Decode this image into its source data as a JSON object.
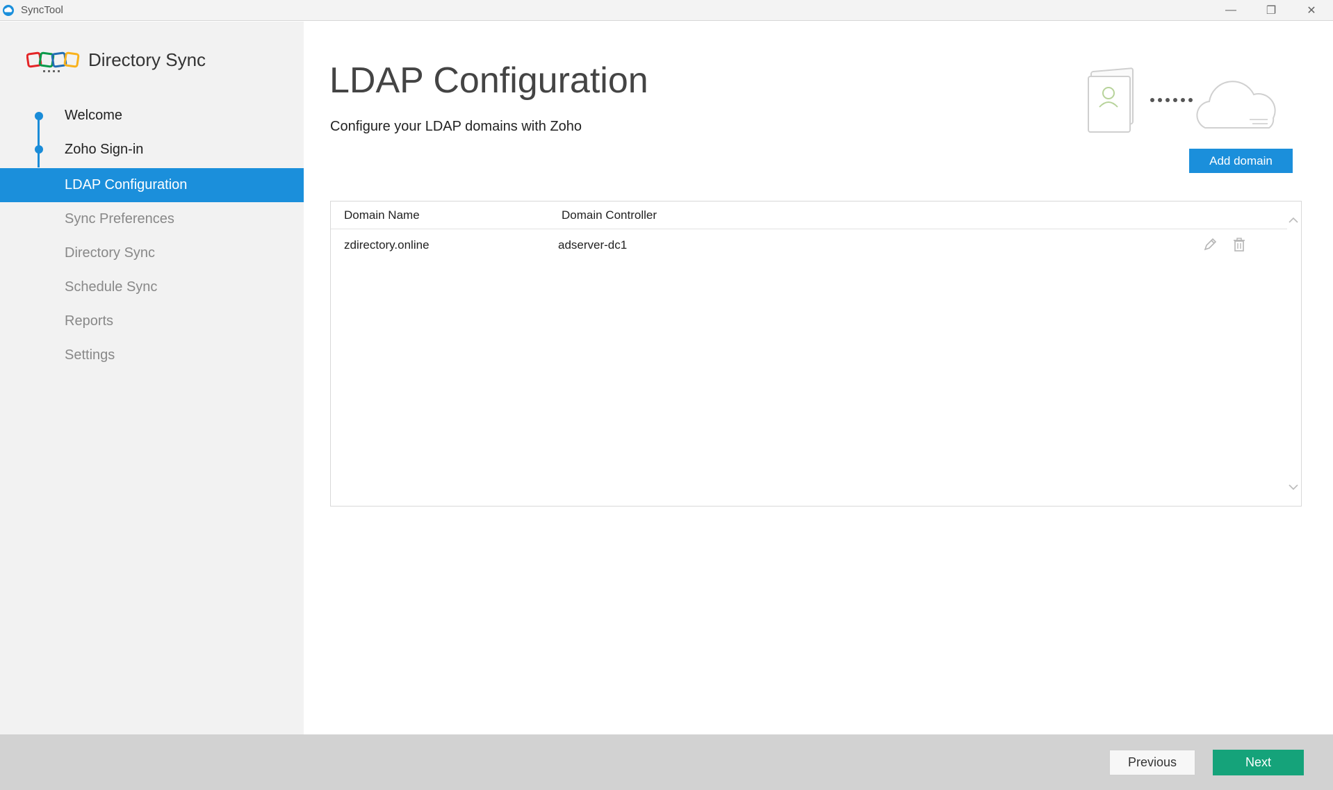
{
  "window": {
    "title": "SyncTool",
    "controls": {
      "minimize": "—",
      "restore": "❐",
      "close": "✕"
    }
  },
  "sidebar": {
    "brand": "Directory Sync",
    "items": [
      {
        "label": "Welcome",
        "state": "done"
      },
      {
        "label": "Zoho Sign-in",
        "state": "done"
      },
      {
        "label": "LDAP Configuration",
        "state": "active"
      },
      {
        "label": "Sync Preferences",
        "state": "pending"
      },
      {
        "label": "Directory Sync",
        "state": "pending"
      },
      {
        "label": "Schedule Sync",
        "state": "pending"
      },
      {
        "label": "Reports",
        "state": "pending"
      },
      {
        "label": "Settings",
        "state": "pending"
      }
    ]
  },
  "main": {
    "title": "LDAP Configuration",
    "subtitle": "Configure your LDAP domains with Zoho",
    "add_button": "Add domain",
    "table": {
      "columns": [
        "Domain Name",
        "Domain Controller"
      ],
      "rows": [
        {
          "domain": "zdirectory.online",
          "controller": "adserver-dc1"
        }
      ]
    }
  },
  "footer": {
    "previous": "Previous",
    "next": "Next"
  },
  "colors": {
    "accent": "#1b8fdb",
    "next_button": "#15a37a",
    "sidebar_bg": "#f2f2f2",
    "footer_bg": "#d2d2d2"
  },
  "icons": [
    "app-icon",
    "zoho-logo",
    "directory-book-icon",
    "cloud-icon",
    "edit-icon",
    "delete-icon"
  ]
}
